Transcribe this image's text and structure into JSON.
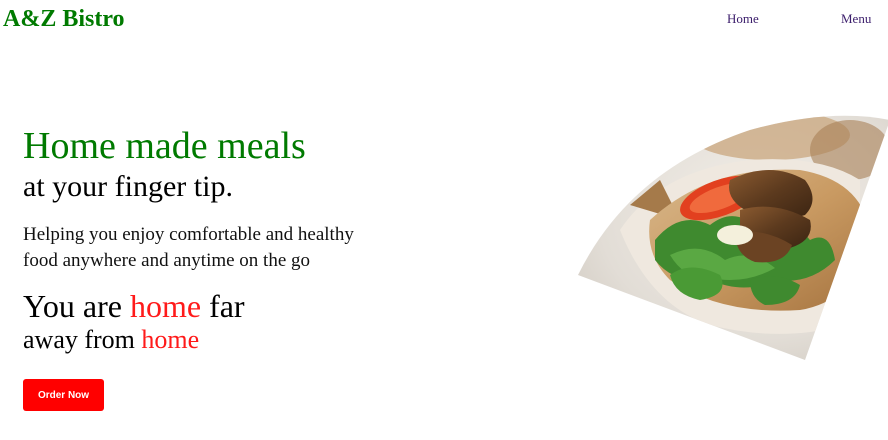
{
  "header": {
    "logo": "A&Z Bistro",
    "nav": {
      "home": "Home",
      "menu": "Menu"
    }
  },
  "hero": {
    "title": "Home made meals",
    "subtitle": "at your finger tip.",
    "description": "Helping you enjoy comfortable and healthy food anywhere and anytime on the go",
    "tagline_line1_a": "You are ",
    "tagline_line1_highlight": "home",
    "tagline_line1_b": " far",
    "tagline_line2_a": "away from ",
    "tagline_line2_highlight": "home",
    "cta_label": "Order Now"
  },
  "colors": {
    "brand_green": "#007a00",
    "accent_red": "#ff0000",
    "nav_text": "#3b1d6b"
  },
  "image": {
    "subject": "food-wrap-image"
  }
}
